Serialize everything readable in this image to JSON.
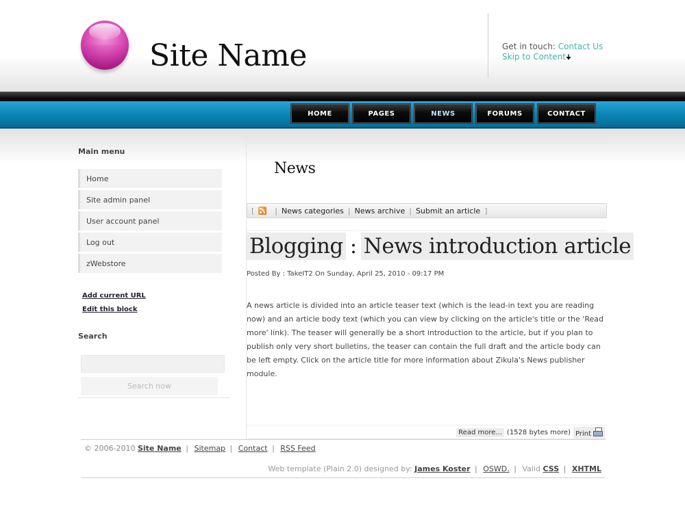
{
  "header": {
    "site_name": "Site Name",
    "contact_prefix": "Get in touch:",
    "contact_link": "Contact Us",
    "skip_link": "Skip to Content",
    "skip_arrow_icon": "arrow-down-icon"
  },
  "nav": {
    "items": [
      {
        "label": "Home"
      },
      {
        "label": "Pages"
      },
      {
        "label": "News"
      },
      {
        "label": "Forums"
      },
      {
        "label": "Contact"
      }
    ],
    "active": "News"
  },
  "sidebar": {
    "main_menu_title": "Main menu",
    "menu_items": [
      {
        "label": "Home"
      },
      {
        "label": "Site admin panel"
      },
      {
        "label": "User account panel"
      },
      {
        "label": "Log out"
      },
      {
        "label": "zWebstore"
      }
    ],
    "add_url": "Add current URL",
    "edit_block": "Edit this block",
    "search_title": "Search",
    "search_input_value": "",
    "search_button": "Search now"
  },
  "content": {
    "section_title": "News",
    "news_bar": {
      "rss_icon": "rss-icon",
      "open_bracket": "[",
      "close_bracket": "]",
      "separator": "|",
      "links": [
        {
          "label": "News categories"
        },
        {
          "label": "News archive"
        },
        {
          "label": "Submit an article"
        }
      ]
    },
    "article": {
      "category": "Blogging",
      "colon": ":",
      "title": "News introduction article",
      "posted_by": "Posted By : TakeIT2 On Sunday, April 25, 2010 - 09:17 PM",
      "body": "A news article is divided into an article teaser text (which is the lead-in text you are reading now) and an article body text (which you can view by clicking on the article's title or the 'Read more' link). The teaser will generally be a short introduction to the article, but if you plan to publish only very short bulletins, the teaser can contain the full draft and the article body can be left empty. Click on the article title for more information about Zikula's News publisher module.",
      "read_more": "Read more...",
      "bytes_more": "(1528 bytes more)",
      "print": "Print",
      "print_icon": "printer-icon"
    }
  },
  "footer": {
    "copyright": "© 2006-2010",
    "site_name": "Site Name",
    "separator": "|",
    "links": [
      {
        "label": "Sitemap"
      },
      {
        "label": "Contact"
      },
      {
        "label": "RSS Feed"
      }
    ],
    "credit_prefix": "Web template (Plain 2.0) designed by:",
    "designer": "James Koster",
    "oswd": "OSWD.",
    "valid_prefix": "Valid",
    "css": "CSS",
    "xhtml": "XHTML"
  }
}
